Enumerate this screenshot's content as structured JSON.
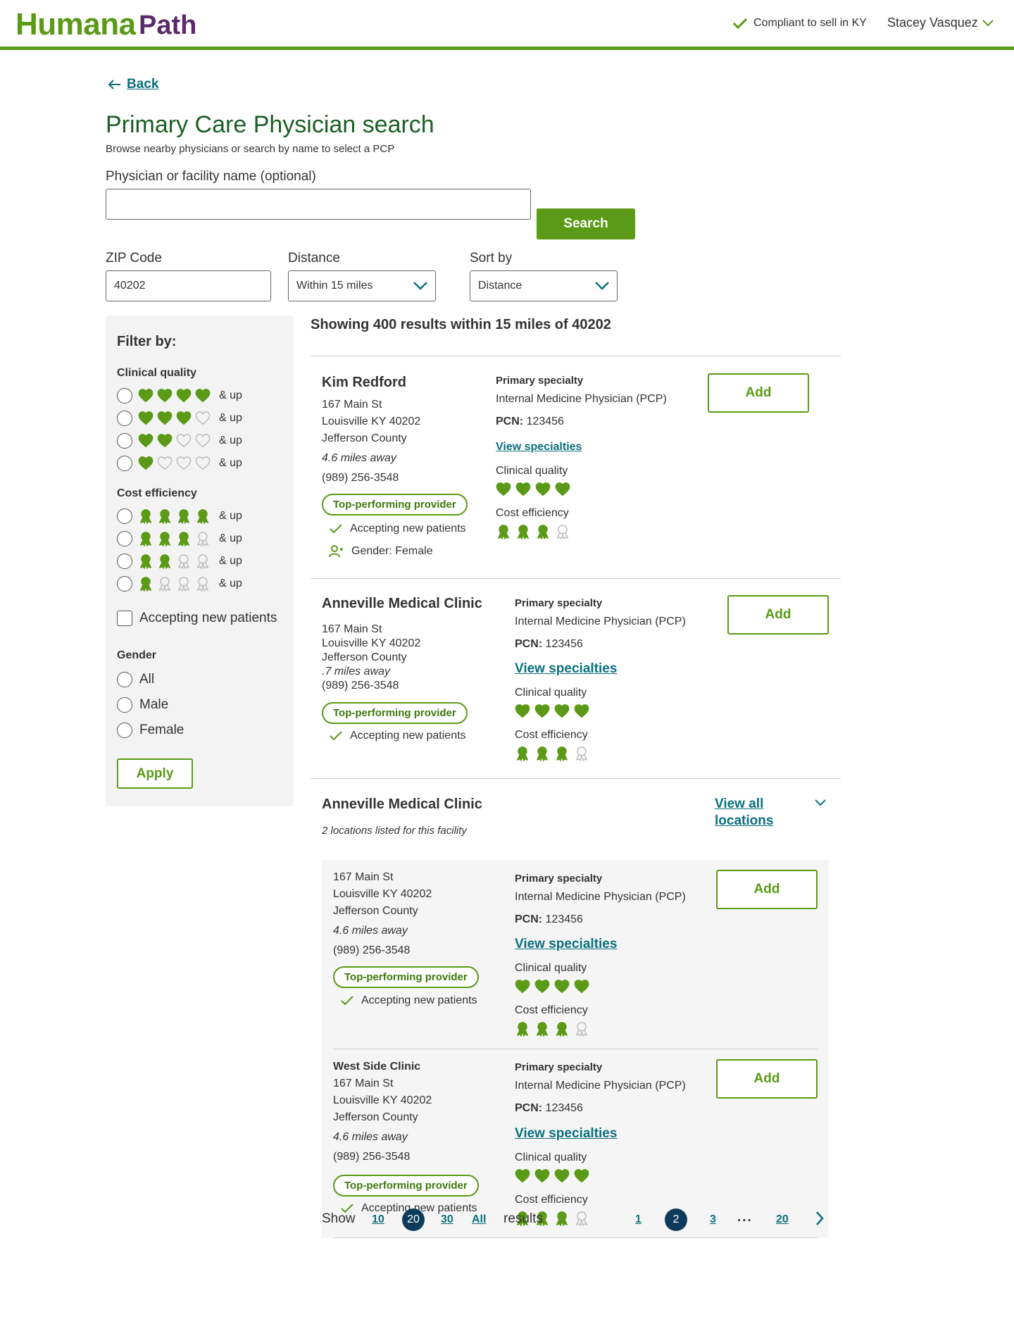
{
  "header": {
    "brand_primary": "Humana",
    "brand_secondary": "Path",
    "compliance": "Compliant to sell in KY",
    "user_name": "Stacey Vasquez"
  },
  "nav": {
    "back_label": "Back"
  },
  "page": {
    "title": "Primary Care Physician search",
    "subtitle": "Browse nearby physicians or search by name to select a PCP"
  },
  "search": {
    "name_label": "Physician or facility name (optional)",
    "name_value": "",
    "search_button": "Search",
    "zip_label": "ZIP Code",
    "zip_value": "40202",
    "distance_label": "Distance",
    "distance_value": "Within 15 miles",
    "sort_label": "Sort by",
    "sort_value": "Distance"
  },
  "filters": {
    "title": "Filter by:",
    "clinical_quality_label": "Clinical quality",
    "cost_efficiency_label": "Cost efficiency",
    "and_up": "& up",
    "rating_levels": [
      4,
      3,
      2,
      1
    ],
    "accepting_label": "Accepting new patients",
    "gender_label": "Gender",
    "gender_options": [
      "All",
      "Male",
      "Female"
    ],
    "apply_button": "Apply"
  },
  "results": {
    "summary": "Showing 400 results within 15 miles of 40202",
    "add_label": "Add",
    "primary_specialty_label": "Primary specialty",
    "pcn_label": "PCN:",
    "view_specialties_label": "View specialties",
    "clinical_quality_label": "Clinical quality",
    "cost_efficiency_label": "Cost efficiency",
    "top_performing_label": "Top-performing provider",
    "accepting_label": "Accepting new patients",
    "cards": [
      {
        "name": "Kim Redford",
        "street": "167 Main St",
        "city": "Louisville KY 40202",
        "county": "Jefferson County",
        "distance": "4.6 miles away",
        "phone": "(989) 256-3548",
        "gender": "Gender: Female",
        "specialty": "Internal Medicine Physician (PCP)",
        "pcn": "123456",
        "clinical_quality": 4,
        "cost_efficiency": 3
      },
      {
        "name": "Anneville Medical Clinic",
        "street": "167 Main St",
        "city": "Louisville KY 40202",
        "county": "Jefferson County",
        "distance": ".7 miles away",
        "phone": "(989) 256-3548",
        "specialty": "Internal Medicine Physician (PCP)",
        "pcn": "123456",
        "clinical_quality": 4,
        "cost_efficiency": 3
      }
    ],
    "facility": {
      "name": "Anneville Medical Clinic",
      "locations_note": "2 locations listed for this facility",
      "view_all_line1": "View all",
      "view_all_line2": "locations",
      "locations": [
        {
          "street": "167 Main St",
          "city": "Louisville KY 40202",
          "county": "Jefferson County",
          "distance": "4.6 miles away",
          "phone": "(989) 256-3548",
          "specialty": "Internal Medicine Physician (PCP)",
          "pcn": "123456",
          "clinical_quality": 4,
          "cost_efficiency": 3
        },
        {
          "name": "West Side Clinic",
          "street": "167 Main St",
          "city": "Louisville KY 40202",
          "county": "Jefferson County",
          "distance": "4.6 miles away",
          "phone": "(989) 256-3548",
          "specialty": "Internal Medicine Physician (PCP)",
          "pcn": "123456",
          "clinical_quality": 4,
          "cost_efficiency": 3
        }
      ]
    }
  },
  "pagination": {
    "show_label": "Show",
    "per_page_options": [
      "10",
      "20",
      "30",
      "All"
    ],
    "per_page_selected": "20",
    "results_label": "results",
    "pages": [
      "1",
      "2",
      "3",
      "20"
    ],
    "current_page": "2",
    "ellipsis": "..."
  },
  "colors": {
    "brand_green": "#5a9a16",
    "brand_purple": "#5c2a6b",
    "title_green": "#1b5f24",
    "link_teal": "#0b6f7e",
    "active_navy": "#0e3b5c",
    "icon_outline": "#bbbbbb"
  },
  "icons": [
    "arrow-left-icon",
    "check-icon",
    "chevron-down-icon",
    "heart-icon",
    "ribbon-award-icon",
    "person-icon",
    "chevron-right-icon"
  ]
}
